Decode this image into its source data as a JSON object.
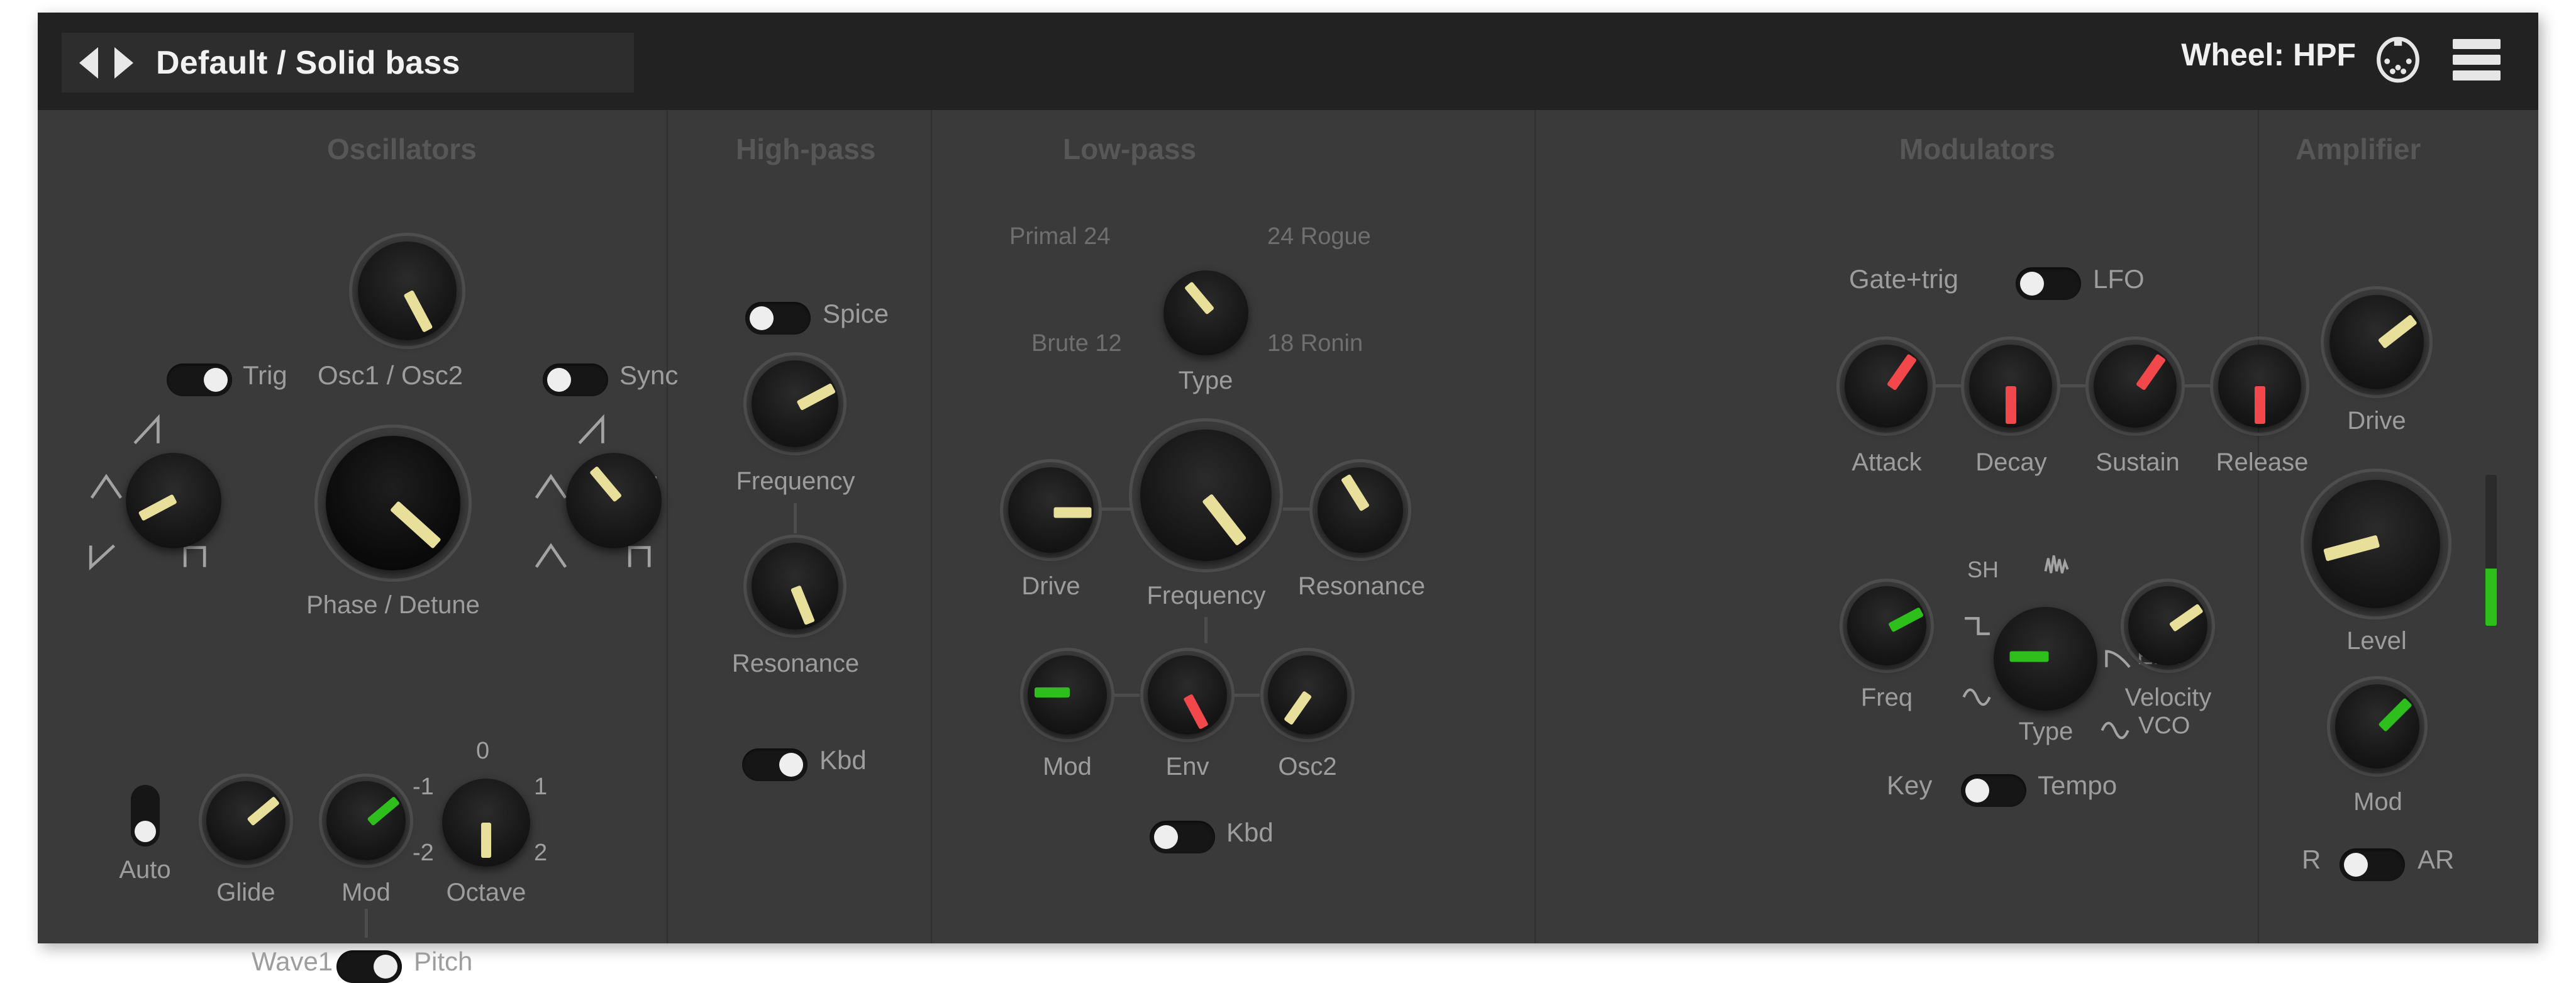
{
  "header": {
    "preset_name": "Default / Solid bass",
    "prev_icon": "triangle-left-icon",
    "next_icon": "triangle-right-icon",
    "wheel_label": "Wheel: HPF",
    "midi_icon": "midi-din-icon",
    "menu_icon": "hamburger-menu-icon"
  },
  "colors": {
    "panel_bg": "#3a3a3a",
    "header_bg": "#222222",
    "pointer_cream": "#e8e09a",
    "pointer_green": "#2fbf1d",
    "pointer_red": "#f2474b",
    "label": "#9d9d9d",
    "section_title": "#575757",
    "meter_green": "#2fbf1d"
  },
  "sections": {
    "oscillators": {
      "title": "Oscillators",
      "osc_mix": {
        "label": "Osc1 / Osc2",
        "pointer_color": "cream",
        "angle": -28
      },
      "trig": {
        "label": "Trig",
        "state": "on"
      },
      "sync": {
        "label": "Sync",
        "state": "off"
      },
      "osc1_wave": {
        "pointer_color": "cream",
        "angle": 62,
        "marks": [
          "saw",
          "triangle",
          "pulse",
          "square"
        ]
      },
      "phase_detune": {
        "label": "Phase / Detune",
        "pointer_color": "cream",
        "angle": -48
      },
      "osc2_wave": {
        "pointer_color": "cream",
        "angle": 140,
        "marks": [
          "saw",
          "triangle",
          "pulse",
          "square"
        ]
      },
      "auto": {
        "label": "Auto",
        "state": "off"
      },
      "glide": {
        "label": "Glide",
        "pointer_color": "cream",
        "angle": -130
      },
      "mod": {
        "label": "Mod",
        "pointer_color": "green",
        "angle": -130
      },
      "octave": {
        "label": "Octave",
        "pointer_color": "cream",
        "angle": 0,
        "ticks": [
          "-2",
          "-1",
          "0",
          "1",
          "2"
        ]
      },
      "wave_pitch": {
        "left_label": "Wave1",
        "right_label": "Pitch",
        "state": "on"
      }
    },
    "highpass": {
      "title": "High-pass",
      "spice": {
        "label": "Spice",
        "state": "off"
      },
      "frequency": {
        "label": "Frequency",
        "pointer_color": "cream",
        "angle": -118
      },
      "resonance": {
        "label": "Resonance",
        "pointer_color": "cream",
        "angle": -22
      },
      "kbd": {
        "label": "Kbd",
        "state": "on"
      }
    },
    "lowpass": {
      "title": "Low-pass",
      "type": {
        "label": "Type",
        "pointer_color": "cream",
        "angle": 140,
        "options": [
          "Primal 24",
          "24 Rogue",
          "Brute 12",
          "18 Ronin"
        ],
        "selected": "18 Ronin"
      },
      "drive": {
        "label": "Drive",
        "pointer_color": "cream",
        "angle": -90
      },
      "frequency": {
        "label": "Frequency",
        "pointer_color": "cream",
        "angle": -38
      },
      "resonance": {
        "label": "Resonance",
        "pointer_color": "cream",
        "angle": 148
      },
      "mod": {
        "label": "Mod",
        "pointer_color": "green",
        "angle": 90
      },
      "env": {
        "label": "Env",
        "pointer_color": "red",
        "angle": -28
      },
      "osc2": {
        "label": "Osc2",
        "pointer_color": "cream",
        "angle": 35
      },
      "kbd": {
        "label": "Kbd",
        "state": "off"
      }
    },
    "modulators": {
      "title": "Modulators",
      "gate_lfo": {
        "left_label": "Gate+trig",
        "right_label": "LFO",
        "state": "off"
      },
      "attack": {
        "label": "Attack",
        "pointer_color": "red",
        "angle": -145
      },
      "decay": {
        "label": "Decay",
        "pointer_color": "red",
        "angle": 0
      },
      "sustain": {
        "label": "Sustain",
        "pointer_color": "red",
        "angle": -145
      },
      "release": {
        "label": "Release",
        "pointer_color": "red",
        "angle": 0
      },
      "freq": {
        "label": "Freq",
        "pointer_color": "green",
        "angle": -118
      },
      "lfo_type": {
        "label": "Type",
        "pointer_color": "green",
        "angle": 90,
        "marks": [
          "SH",
          "noise",
          "square",
          "sine",
          "ENV",
          "VCO"
        ],
        "env_label": "ENV",
        "vco_label": "VCO",
        "sh_label": "SH"
      },
      "velocity": {
        "label": "Velocity",
        "pointer_color": "cream",
        "angle": -125
      },
      "key_tempo": {
        "left_label": "Key",
        "right_label": "Tempo",
        "state": "off"
      }
    },
    "amplifier": {
      "title": "Amplifier",
      "drive": {
        "label": "Drive",
        "pointer_color": "cream",
        "angle": -128
      },
      "level": {
        "label": "Level",
        "pointer_color": "cream",
        "angle": 75
      },
      "meter": {
        "value_percent": 38
      },
      "mod": {
        "label": "Mod",
        "pointer_color": "green",
        "angle": -135
      },
      "r_ar": {
        "left_label": "R",
        "right_label": "AR",
        "state": "off"
      }
    }
  }
}
